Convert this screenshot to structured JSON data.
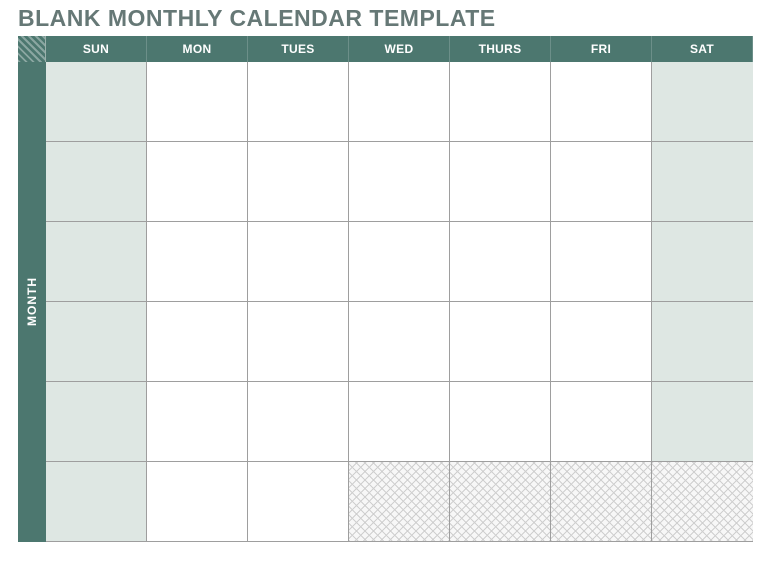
{
  "title": "BLANK MONTHLY CALENDAR TEMPLATE",
  "month_label": "MONTH",
  "days": [
    "SUN",
    "MON",
    "TUES",
    "WED",
    "THURS",
    "FRI",
    "SAT"
  ],
  "rows": 6,
  "weekend_columns": [
    0,
    6
  ],
  "hatched_cells": [
    {
      "row": 5,
      "col": 3
    },
    {
      "row": 5,
      "col": 4
    },
    {
      "row": 5,
      "col": 5
    },
    {
      "row": 5,
      "col": 6
    }
  ],
  "colors": {
    "header_bg": "#4c776f",
    "weekend_bg": "#dee7e3",
    "title_color": "#667876",
    "grid_line": "#9e9e9e"
  }
}
